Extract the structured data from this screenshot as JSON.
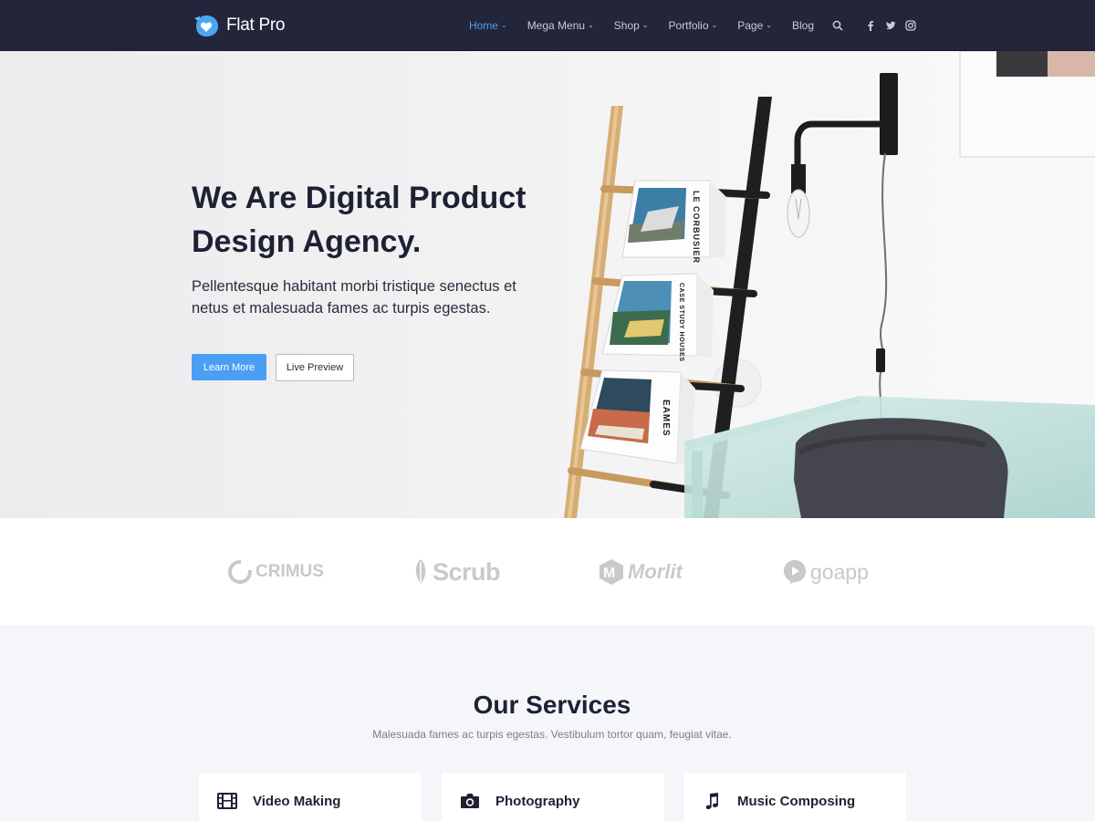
{
  "navbar": {
    "brand": "Flat Pro",
    "items": [
      {
        "label": "Home",
        "dropdown": true,
        "active": true
      },
      {
        "label": "Mega Menu",
        "dropdown": true,
        "active": false
      },
      {
        "label": "Shop",
        "dropdown": true,
        "active": false
      },
      {
        "label": "Portfolio",
        "dropdown": true,
        "active": false
      },
      {
        "label": "Page",
        "dropdown": true,
        "active": false
      },
      {
        "label": "Blog",
        "dropdown": false,
        "active": false
      }
    ],
    "icons": [
      "search-icon",
      "facebook-icon",
      "twitter-icon",
      "instagram-icon"
    ]
  },
  "hero": {
    "title": "We Are Digital Product Design Agency.",
    "subtitle": "Pellentesque habitant morbi tristique senectus et netus et malesuada fames ac turpis egestas.",
    "primary_button": "Learn More",
    "secondary_button": "Live Preview",
    "magazines": [
      "LE CORBUSIER",
      "CASE STUDY HOUSES",
      "EAMES"
    ]
  },
  "partners": [
    "CRIMUS",
    "Scrub",
    "Morlit",
    "goapp"
  ],
  "services": {
    "title": "Our Services",
    "subtitle": "Malesuada fames ac turpis egestas. Vestibulum tortor quam, feugiat vitae.",
    "cards": [
      {
        "label": "Video Making",
        "icon": "film-icon"
      },
      {
        "label": "Photography",
        "icon": "camera-icon"
      },
      {
        "label": "Music Composing",
        "icon": "music-note-icon"
      }
    ]
  },
  "colors": {
    "navbar_bg": "#23253a",
    "accent": "#4a9ff5",
    "heading": "#1e2133",
    "services_bg": "#f5f6f9"
  }
}
